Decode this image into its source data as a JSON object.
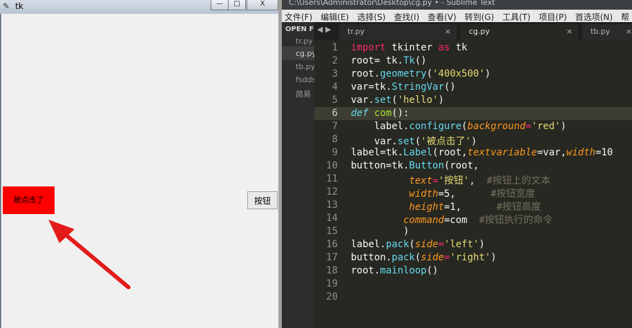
{
  "tk_window": {
    "title": "tk",
    "controls": {
      "minimize": "—",
      "maximize": "□",
      "close": "X"
    },
    "label_text": "被点击了",
    "button_text": "按钮",
    "label_bg": "#ff0000"
  },
  "sublime": {
    "title": "C:\\Users\\Administrator\\Desktop\\cg.py • - Sublime Text",
    "menu": [
      "文件(F)",
      "编辑(E)",
      "选择(S)",
      "查找(I)",
      "查看(V)",
      "转到(G)",
      "工具(T)",
      "项目(P)",
      "首选项(N)",
      "帮"
    ],
    "sidebar": {
      "header": "OPEN FI",
      "items": [
        "tr.py",
        "cg.py",
        "tb.py",
        "fsdds",
        "简易"
      ]
    },
    "tabs": [
      {
        "label": "tr.py",
        "close": "×"
      },
      {
        "label": "cg.py",
        "close": "×"
      },
      {
        "label": "tb.py",
        "close": "×"
      }
    ],
    "tab_nav": "◀ ▶",
    "line_numbers": [
      "1",
      "2",
      "3",
      "4",
      "5",
      "6",
      "7",
      "8",
      "9",
      "10",
      "11",
      "12",
      "13",
      "14",
      "15",
      "16",
      "17",
      "18",
      "19",
      "20"
    ],
    "code": {
      "l1": {
        "a": "import",
        "b": " tkinter ",
        "c": "as",
        "d": " tk"
      },
      "l2": {
        "a": "root= tk.",
        "b": "Tk",
        "c": "()"
      },
      "l3": {
        "a": "root.",
        "b": "geometry",
        "c": "(",
        "d": "'400x500'",
        "e": ")"
      },
      "l4": {
        "a": "var=tk.",
        "b": "StringVar",
        "c": "()"
      },
      "l5": {
        "a": "var.",
        "b": "set",
        "c": "(",
        "d": "'hello'",
        "e": ")"
      },
      "l6": {
        "a": "def",
        "b": " com",
        "c": "():"
      },
      "l7": {
        "a": "    label.",
        "b": "configure",
        "c": "(",
        "d": "background",
        "e": "=",
        "f": "'red'",
        "g": ")"
      },
      "l8": {
        "a": "    var.",
        "b": "set",
        "c": "(",
        "d": "'被点击了'",
        "e": ")"
      },
      "l9": {
        "a": "label=tk.",
        "b": "Label",
        "c": "(root,",
        "d": "textvariable",
        "e": "=var,",
        "f": "width",
        "g": "=10"
      },
      "l10": {
        "a": "button=tk.",
        "b": "Button",
        "c": "(root,"
      },
      "l11": {
        "a": "          ",
        "b": "text",
        "c": "=",
        "d": "'按钮'",
        "e": ",  ",
        "f": "#按钮上的文本"
      },
      "l12": {
        "a": "          ",
        "b": "width",
        "c": "=5,      ",
        "d": "#按钮宽度"
      },
      "l13": {
        "a": "          ",
        "b": "height",
        "c": "=1,      ",
        "d": "#按钮高度"
      },
      "l14": {
        "a": "         ",
        "b": "command",
        "c": "=com  ",
        "d": "#按钮执行的命令"
      },
      "l15": {
        "a": "         )"
      },
      "l16": {
        "a": "label.",
        "b": "pack",
        "c": "(",
        "d": "side",
        "e": "=",
        "f": "'left'",
        "g": ")"
      },
      "l17": {
        "a": "button.",
        "b": "pack",
        "c": "(",
        "d": "side",
        "e": "=",
        "f": "'right'",
        "g": ")"
      },
      "l18": {
        "a": "root.",
        "b": "mainloop",
        "c": "()"
      }
    }
  },
  "colors": {
    "accent_red": "#ff0000",
    "editor_bg": "#272822",
    "keyword": "#f92672",
    "function": "#66d9ef",
    "string": "#e6db74",
    "param": "#fd971f",
    "comment": "#75715e"
  }
}
